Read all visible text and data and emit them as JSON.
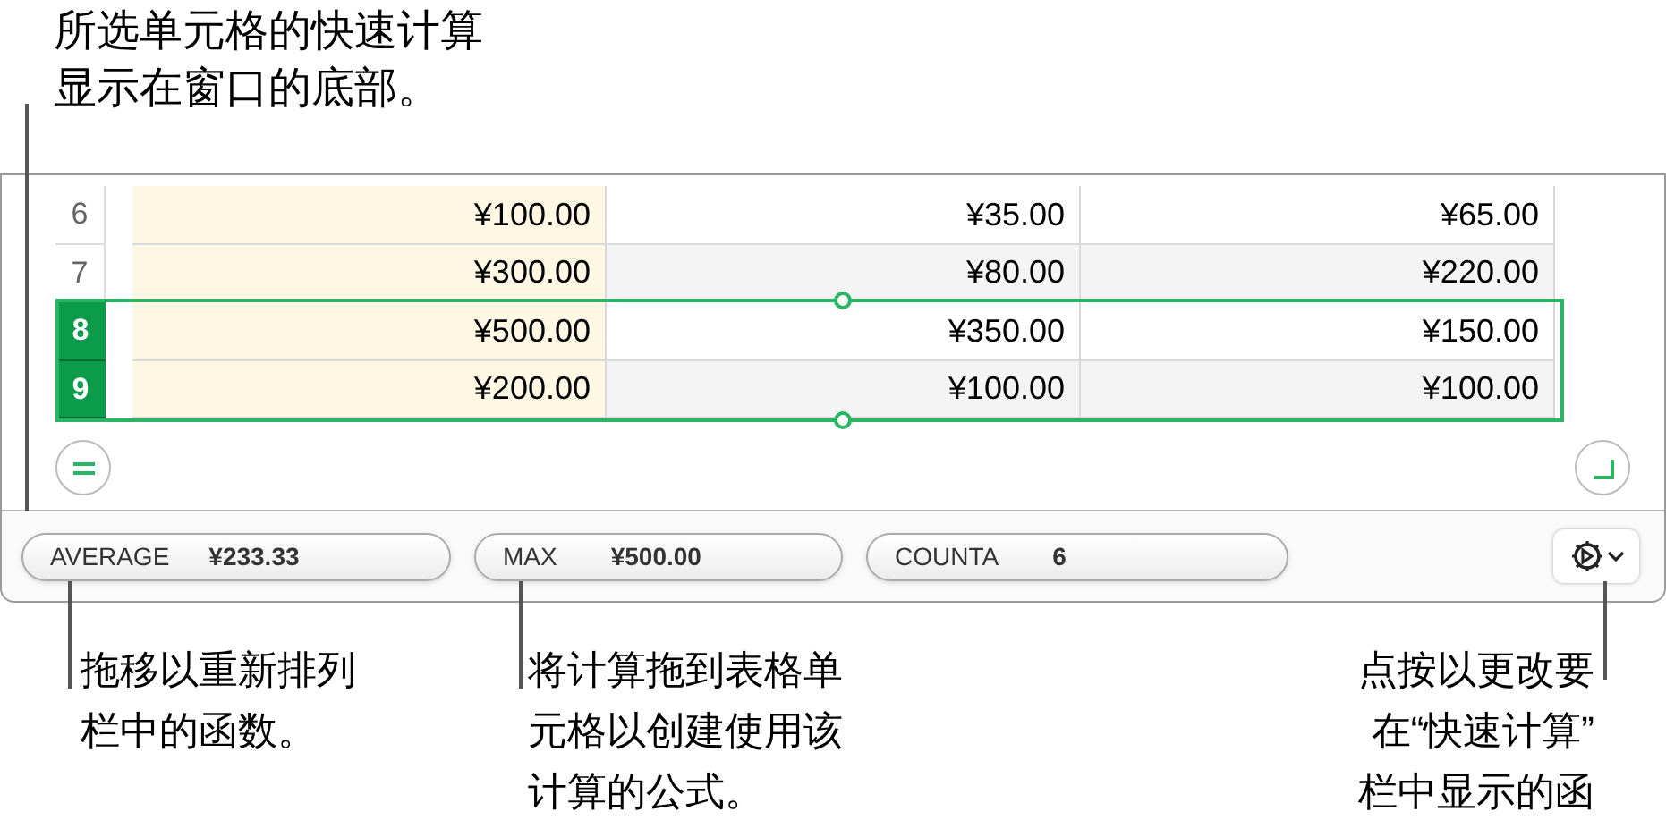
{
  "top_callout": {
    "lines": [
      "所选单元格的快速计算",
      "显示在窗口的底部。"
    ]
  },
  "table": {
    "rows": [
      {
        "number": "6",
        "selected": false,
        "cells": [
          "¥100.00",
          "¥35.00",
          "¥65.00"
        ]
      },
      {
        "number": "7",
        "selected": false,
        "cells": [
          "¥300.00",
          "¥80.00",
          "¥220.00"
        ]
      },
      {
        "number": "8",
        "selected": true,
        "cells": [
          "¥500.00",
          "¥350.00",
          "¥150.00"
        ]
      },
      {
        "number": "9",
        "selected": true,
        "cells": [
          "¥200.00",
          "¥100.00",
          "¥100.00"
        ]
      }
    ]
  },
  "quick_calc_bar": {
    "pills": [
      {
        "label": "AVERAGE",
        "value": "¥233.33"
      },
      {
        "label": "MAX",
        "value": "¥500.00"
      },
      {
        "label": "COUNTA",
        "value": "6"
      }
    ]
  },
  "bottom_callouts": [
    {
      "lines": [
        "拖移以重新排列",
        "栏中的函数。"
      ]
    },
    {
      "lines": [
        "将计算拖到表格单",
        "元格以创建使用该",
        "计算的公式。"
      ]
    },
    {
      "lines": [
        "点按以更改要",
        "在“快速计算”",
        "栏中显示的函"
      ]
    }
  ]
}
